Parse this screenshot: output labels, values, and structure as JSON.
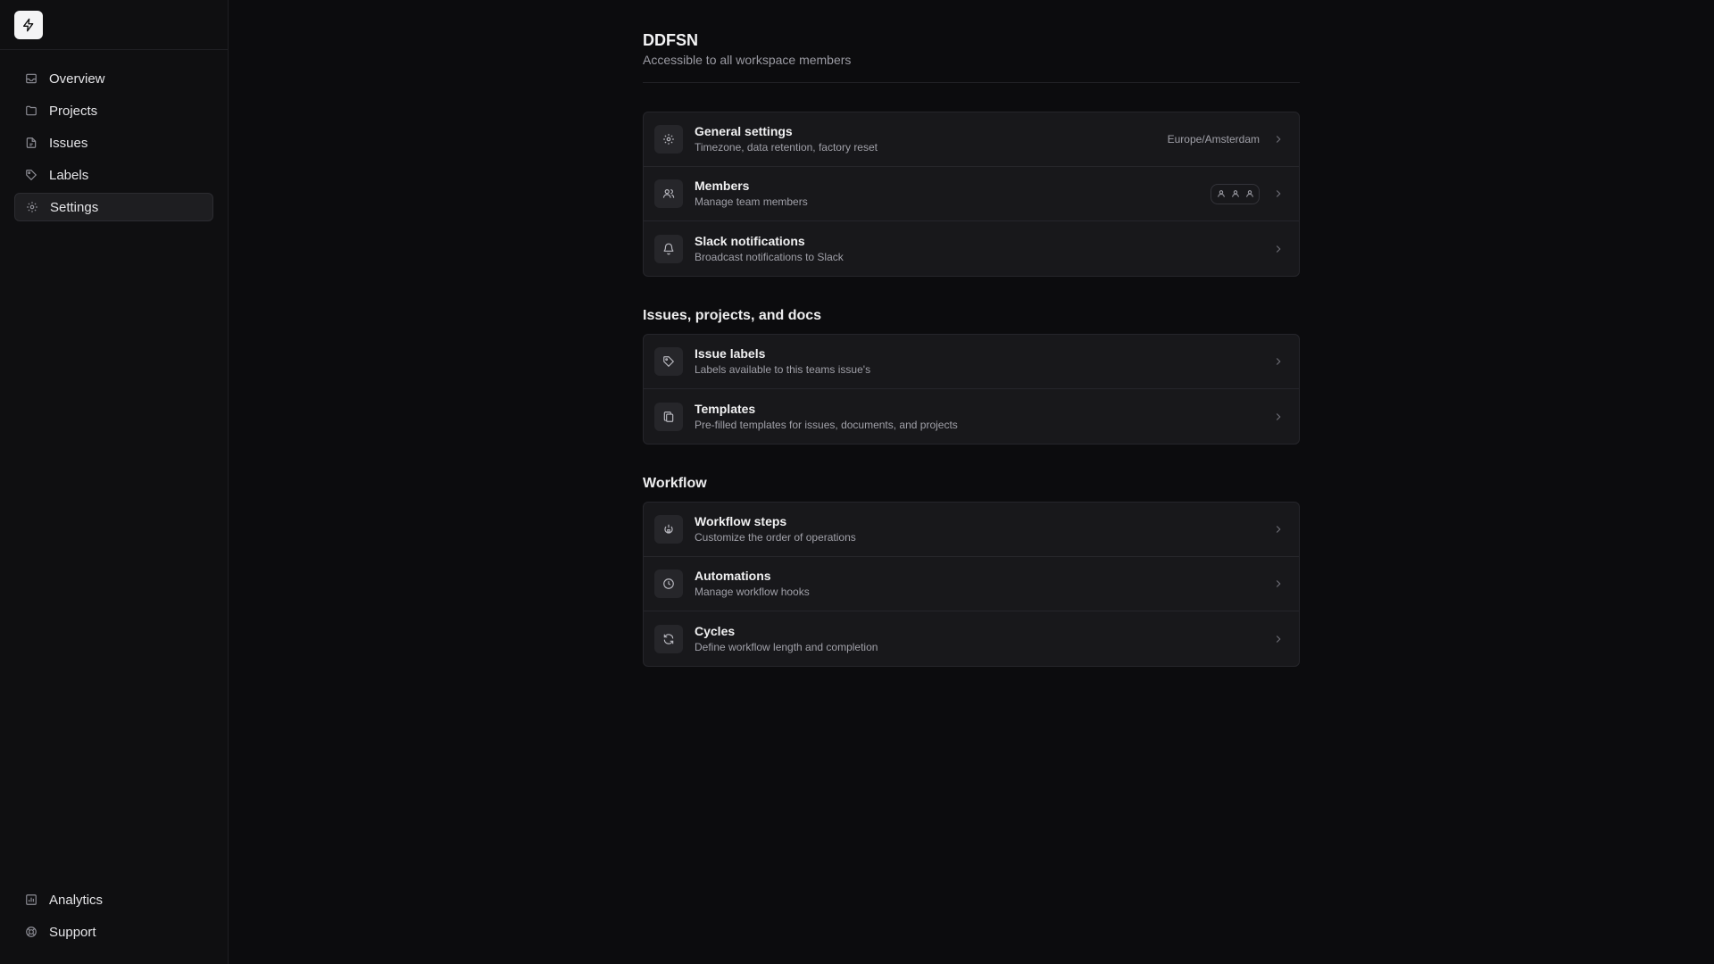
{
  "sidebar": {
    "logo_icon": "bolt-icon",
    "items": [
      {
        "label": "Overview",
        "icon": "inbox-icon"
      },
      {
        "label": "Projects",
        "icon": "folder-icon"
      },
      {
        "label": "Issues",
        "icon": "file-icon"
      },
      {
        "label": "Labels",
        "icon": "tag-icon"
      },
      {
        "label": "Settings",
        "icon": "gear-icon",
        "active": true
      }
    ],
    "bottom_items": [
      {
        "label": "Analytics",
        "icon": "chart-icon"
      },
      {
        "label": "Support",
        "icon": "lifebuoy-icon"
      }
    ]
  },
  "header": {
    "title": "DDFSN",
    "subtitle": "Accessible to all workspace members"
  },
  "general": {
    "rows": [
      {
        "title": "General settings",
        "desc": "Timezone, data retention, factory reset",
        "meta": "Europe/Amsterdam",
        "icon": "gear-icon"
      },
      {
        "title": "Members",
        "desc": "Manage team members",
        "icon": "users-icon"
      },
      {
        "title": "Slack notifications",
        "desc": "Broadcast notifications to Slack",
        "icon": "bell-icon"
      }
    ]
  },
  "issues_section": {
    "title": "Issues, projects, and docs",
    "rows": [
      {
        "title": "Issue labels",
        "desc": "Labels available to this teams issue's",
        "icon": "tag-icon"
      },
      {
        "title": "Templates",
        "desc": "Pre-filled templates for issues, documents, and projects",
        "icon": "copy-icon"
      }
    ]
  },
  "workflow_section": {
    "title": "Workflow",
    "rows": [
      {
        "title": "Workflow steps",
        "desc": "Customize the order of operations",
        "icon": "steps-icon"
      },
      {
        "title": "Automations",
        "desc": "Manage workflow hooks",
        "icon": "clock-icon"
      },
      {
        "title": "Cycles",
        "desc": "Define workflow length and completion",
        "icon": "refresh-icon"
      }
    ]
  },
  "colors": {
    "background": "#0c0c0e",
    "sidebar": "#0f0f11",
    "card": "#18181b",
    "border": "#26262b",
    "text": "#f1f1f2",
    "muted": "#a0a0a8"
  }
}
